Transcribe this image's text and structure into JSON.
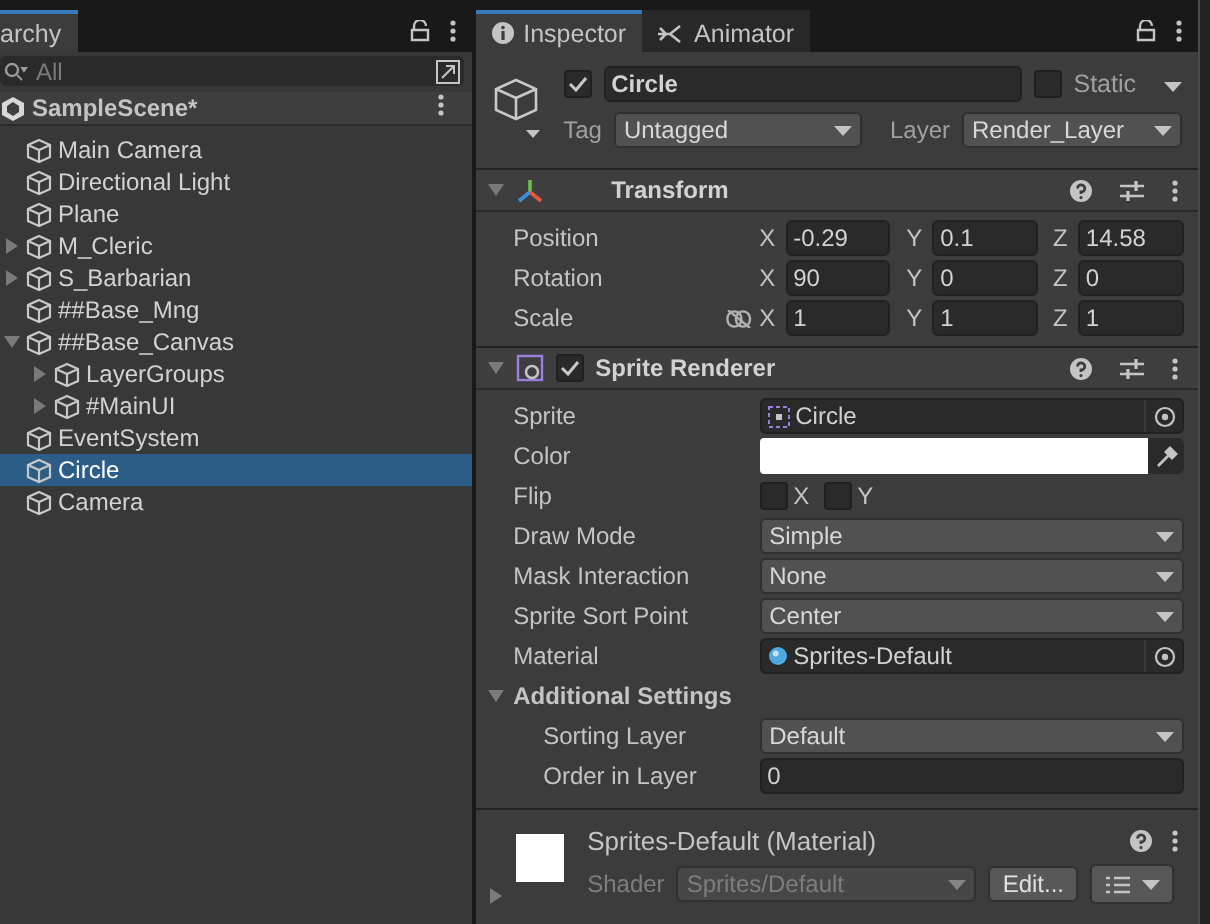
{
  "hierarchy": {
    "tab": {
      "label": "archy",
      "selected": true
    },
    "search": {
      "placeholder": "All"
    },
    "scene": "SampleScene*",
    "items": [
      {
        "name": "Main Camera",
        "selected": false
      },
      {
        "name": "Directional Light",
        "selected": false
      },
      {
        "name": "Plane",
        "selected": false
      },
      {
        "name": "M_Cleric",
        "selected": false,
        "expanded": false
      },
      {
        "name": "S_Barbarian",
        "selected": false,
        "expanded": false
      },
      {
        "name": "##Base_Mng",
        "selected": false
      },
      {
        "name": "##Base_Canvas",
        "selected": false,
        "expanded": true,
        "children": [
          {
            "name": "LayerGroups",
            "selected": false,
            "expanded": false
          },
          {
            "name": "#MainUI",
            "selected": false,
            "expanded": false
          }
        ]
      },
      {
        "name": "EventSystem",
        "selected": false
      },
      {
        "name": "Circle",
        "selected": true
      },
      {
        "name": "Camera",
        "selected": false
      }
    ]
  },
  "inspector": {
    "tabs": [
      {
        "label": "Inspector",
        "kind": "info",
        "selected": true
      },
      {
        "label": "Animator",
        "kind": "animator",
        "selected": false
      }
    ],
    "object": {
      "active": true,
      "name": "Circle",
      "static": false,
      "static_label": "Static",
      "tag_label": "Tag",
      "tag": "Untagged",
      "layer_label": "Layer",
      "layer": "Render_Layer"
    },
    "components": [
      {
        "kind": "transform",
        "title": "Transform",
        "expanded": true,
        "rows": [
          {
            "label": "Position",
            "values": [
              {
                "axis": "X",
                "value": "-0.29"
              },
              {
                "axis": "Y",
                "value": "0.1"
              },
              {
                "axis": "Z",
                "value": "14.58"
              }
            ]
          },
          {
            "label": "Rotation",
            "values": [
              {
                "axis": "X",
                "value": "90"
              },
              {
                "axis": "Y",
                "value": "0"
              },
              {
                "axis": "Z",
                "value": "0"
              }
            ]
          },
          {
            "label": "Scale",
            "constrained": false,
            "values": [
              {
                "axis": "X",
                "value": "1"
              },
              {
                "axis": "Y",
                "value": "1"
              },
              {
                "axis": "Z",
                "value": "1"
              }
            ]
          }
        ]
      },
      {
        "kind": "sprite_renderer",
        "title": "Sprite Renderer",
        "expanded": true,
        "enabled": true,
        "fields": [
          {
            "kind": "sprite_object",
            "label": "Sprite",
            "value": "Circle"
          },
          {
            "kind": "color",
            "label": "Color",
            "color": "#ffffff"
          },
          {
            "kind": "flip",
            "label": "Flip",
            "options": [
              {
                "label": "X",
                "checked": false
              },
              {
                "label": "Y",
                "checked": false
              }
            ]
          },
          {
            "kind": "dropdown",
            "label": "Draw Mode",
            "value": "Simple"
          },
          {
            "kind": "dropdown",
            "label": "Mask Interaction",
            "value": "None"
          },
          {
            "kind": "dropdown",
            "label": "Sprite Sort Point",
            "value": "Center"
          },
          {
            "kind": "material_object",
            "label": "Material",
            "value": "Sprites-Default"
          },
          {
            "kind": "foldout",
            "label": "Additional Settings",
            "expanded": true,
            "children": [
              {
                "kind": "dropdown",
                "label": "Sorting Layer",
                "value": "Default"
              },
              {
                "kind": "text",
                "label": "Order in Layer",
                "value": "0"
              }
            ]
          }
        ]
      }
    ],
    "material": {
      "title": "Sprites-Default (Material)",
      "expanded": false,
      "shader_label": "Shader",
      "shader": "Sprites/Default",
      "shader_disabled": true,
      "edit_button": "Edit..."
    }
  }
}
